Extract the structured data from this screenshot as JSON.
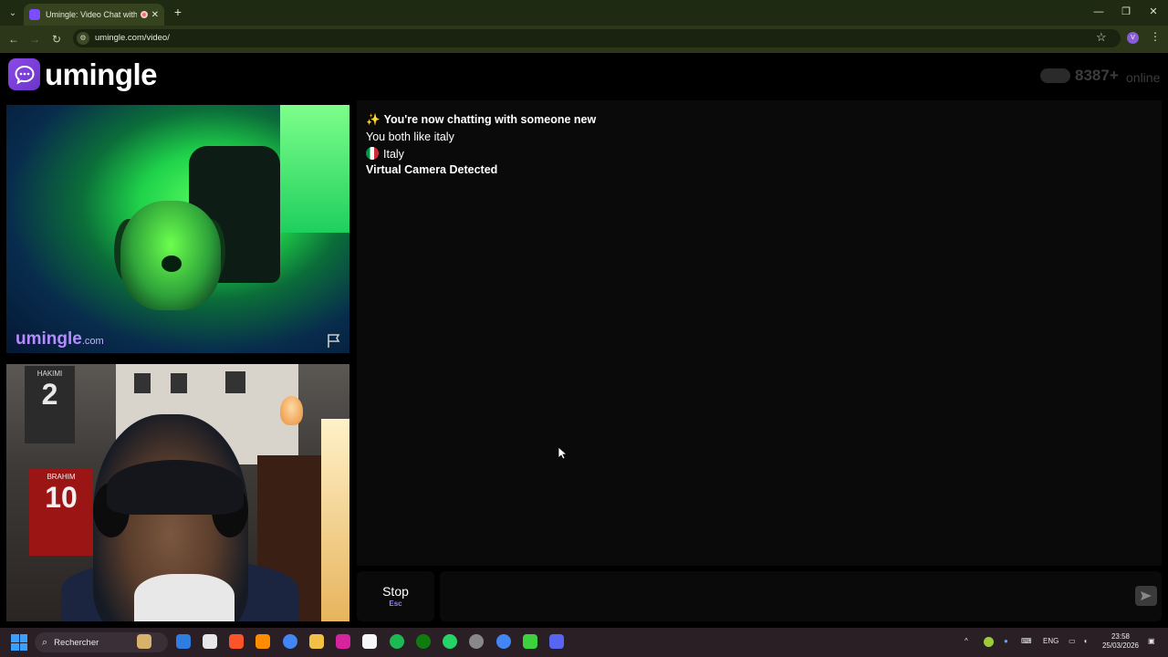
{
  "browser": {
    "tab_title": "Umingle: Video Chat with S",
    "url": "umingle.com/video/"
  },
  "header": {
    "logo_text": "umingle",
    "online_count": "8387+",
    "online_label": "online"
  },
  "video": {
    "watermark_main": "umingle",
    "watermark_domain": ".com",
    "poster_number_1": "2",
    "poster_name_1": "HAKIMI",
    "poster_number_2": "10",
    "poster_name_2": "BRAHIM"
  },
  "chat": {
    "messages": [
      {
        "icon": "✨",
        "text": "You're now chatting with someone new"
      },
      {
        "text": "You both like italy"
      },
      {
        "text": "Italy"
      },
      {
        "text": "Virtual Camera Detected"
      }
    ]
  },
  "controls": {
    "stop_label": "Stop",
    "stop_shortcut": "Esc",
    "message_placeholder": ""
  },
  "taskbar": {
    "search_placeholder": "Rechercher",
    "language": "ENG",
    "time": "23:58",
    "date": "25/03/2026"
  },
  "colors": {
    "brand": "#8d49e8",
    "chat_bg": "#0a0a0a",
    "taskbar_bg": "#2a1f25",
    "browser_bg": "#2b3718"
  }
}
